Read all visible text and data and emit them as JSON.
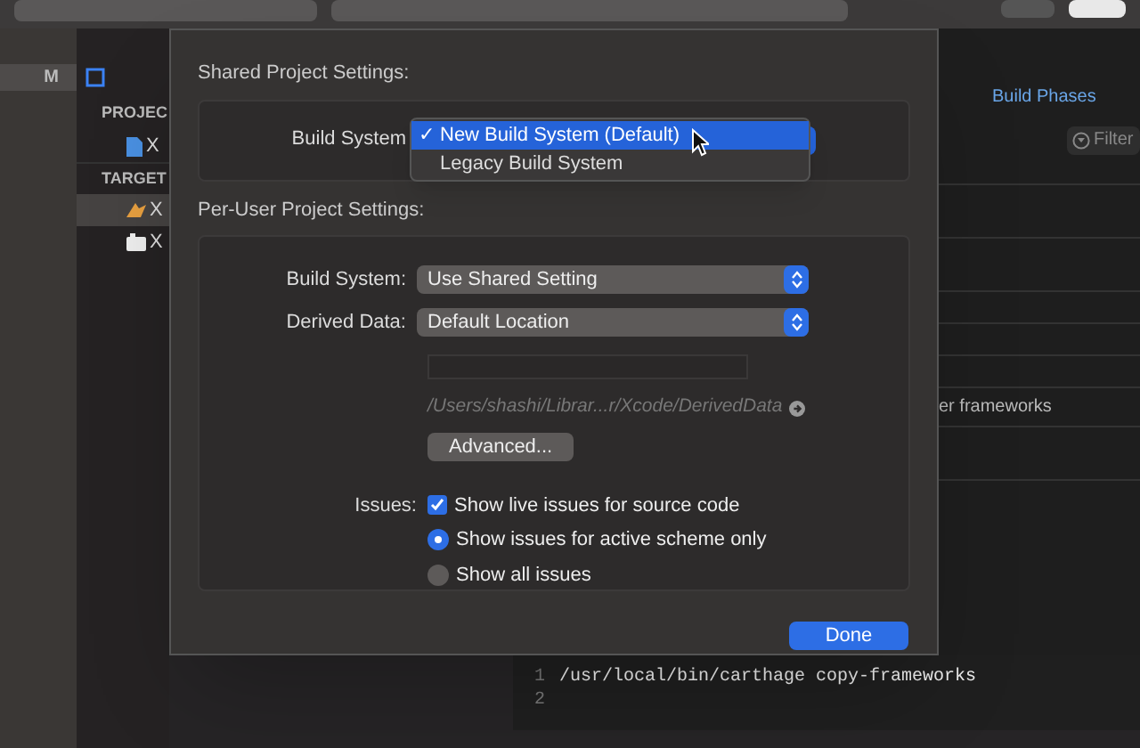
{
  "sidebar": {
    "badge": "M"
  },
  "navigator": {
    "sections": [
      {
        "header": "PROJEC",
        "items": [
          {
            "kind": "project",
            "label": "X",
            "selected": false
          }
        ]
      },
      {
        "header": "TARGET",
        "items": [
          {
            "kind": "target",
            "label": "X",
            "selected": true
          },
          {
            "kind": "framework",
            "label": "X",
            "selected": false
          }
        ]
      }
    ]
  },
  "editor": {
    "tab": "Build Phases",
    "filter_placeholder": "Filter",
    "row_text": "er frameworks",
    "code_lines": [
      {
        "number": "1",
        "text": "/usr/local/bin/carthage copy-frameworks"
      },
      {
        "number": "2"
      }
    ]
  },
  "sheet": {
    "shared_heading": "Shared Project Settings:",
    "shared_label": "Build System",
    "menu_check": "✓",
    "build_system_menu": [
      {
        "label": "New Build System (Default)",
        "selected": true
      },
      {
        "label": "Legacy Build System",
        "selected": false
      }
    ],
    "per_user_heading": "Per-User Project Settings:",
    "rows": [
      {
        "label": "Build System:",
        "value": "Use Shared Setting"
      },
      {
        "label": "Derived Data:",
        "value": "Default Location"
      }
    ],
    "derived_path": "/Users/shashi/Librar...r/Xcode/DerivedData",
    "advanced_button": "Advanced...",
    "issues_label": "Issues:",
    "issue_options": [
      {
        "kind": "checkbox",
        "label": "Show live issues for source code",
        "checked": true
      },
      {
        "kind": "radio",
        "label": "Show issues for active scheme only",
        "selected": true
      },
      {
        "kind": "radio",
        "label": "Show all issues",
        "selected": false
      }
    ],
    "done_button": "Done"
  }
}
